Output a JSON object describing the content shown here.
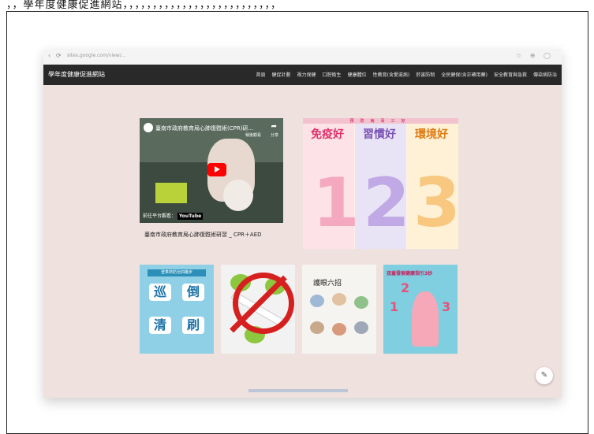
{
  "doc": {
    "top_text": "，，學年度健康促進網站，，，，，，，，，，，，，，，，，，，，，，，，，，"
  },
  "browser": {
    "back": "‹",
    "reload": "⟳",
    "url": "sites.google.com/view/...",
    "icons": "☆ ⊕ ◯"
  },
  "site": {
    "title": "學年度健康促進網站",
    "menu": [
      "首頁",
      "健促計劃",
      "視力保健",
      "口腔衛生",
      "健康體位",
      "性教育(含愛滋病)",
      "菸害防制",
      "全民健保(含正確用藥)",
      "安全教育與急救",
      "傳染病防治"
    ]
  },
  "video": {
    "title": "臺南市政府教育局心肺復甦術(CPR)研...",
    "share_label": "分享",
    "later_label": "稍後觀看",
    "watch_on": "前往平台觀看：",
    "platform": "YouTube",
    "caption": "臺南市政府教育局心肺復甦術研習 _ CPR＋AED"
  },
  "poster": {
    "band": "預防病毒三好",
    "titles": [
      "免疫好",
      "習慣好",
      "環境好"
    ],
    "numbers": [
      "1",
      "2",
      "3"
    ]
  },
  "tiles": {
    "dengue": {
      "header": "登革熱防治四撇步",
      "chars": [
        "巡",
        "倒",
        "清",
        "刷"
      ]
    },
    "eyes": {
      "title": "護眼六招"
    },
    "growth": {
      "title": "孩童發展健康指引3妙",
      "nums": [
        "1",
        "2",
        "3"
      ]
    }
  },
  "controls": {
    "edit_icon_glyph": "✎"
  }
}
